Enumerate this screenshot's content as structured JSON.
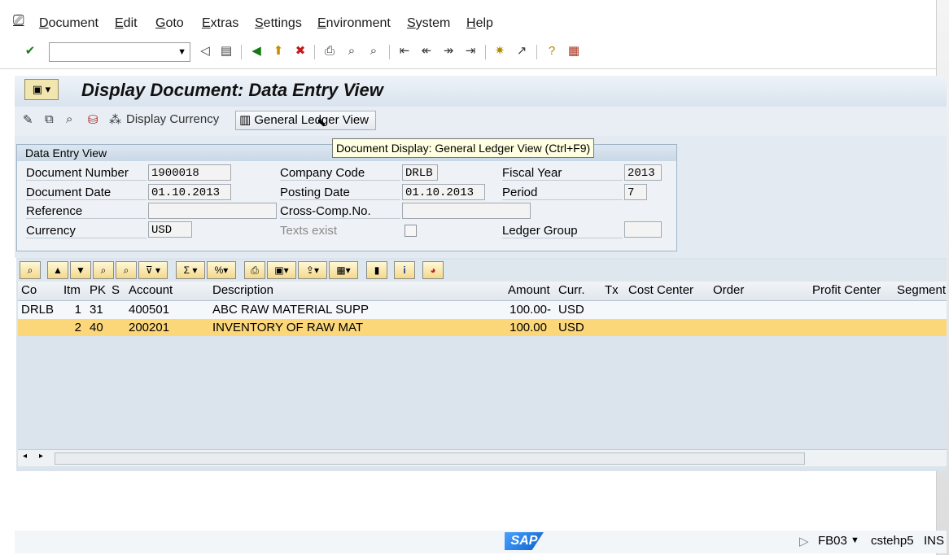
{
  "menu": {
    "items": [
      "Document",
      "Edit",
      "Goto",
      "Extras",
      "Settings",
      "Environment",
      "System",
      "Help"
    ]
  },
  "toolbar": {
    "command_field_value": "",
    "icons": [
      "enter-check-icon",
      "back-triangle-icon",
      "save-icon",
      "back-green-icon",
      "exit-icon",
      "cancel-icon",
      "print-icon",
      "find-icon",
      "find-next-icon",
      "first-page-icon",
      "prev-page-icon",
      "next-page-icon",
      "last-page-icon",
      "create-session-icon",
      "shortcut-icon",
      "help-icon",
      "customize-layout-icon"
    ]
  },
  "title": "Display Document: Data Entry View",
  "app_toolbar": {
    "display_currency_label": "Display Currency",
    "general_ledger_label": "General Ledger View"
  },
  "tooltip": "Document Display: General Ledger View    (Ctrl+F9)",
  "group": {
    "title": "Data Entry View",
    "document_number_label": "Document Number",
    "document_number": "1900018",
    "company_code_label": "Company Code",
    "company_code": "DRLB",
    "fiscal_year_label": "Fiscal Year",
    "fiscal_year": "2013",
    "document_date_label": "Document Date",
    "document_date": "01.10.2013",
    "posting_date_label": "Posting Date",
    "posting_date": "01.10.2013",
    "period_label": "Period",
    "period": "7",
    "reference_label": "Reference",
    "reference": "",
    "cross_comp_label": "Cross-Comp.No.",
    "cross_comp": "",
    "currency_label": "Currency",
    "currency": "USD",
    "texts_exist_label": "Texts exist",
    "ledger_group_label": "Ledger Group",
    "ledger_group": ""
  },
  "table": {
    "columns": [
      "Co",
      "Itm",
      "PK",
      "S",
      "Account",
      "Description",
      "Amount",
      "Curr.",
      "Tx",
      "Cost Center",
      "Order",
      "Profit Center",
      "Segment"
    ],
    "rows": [
      {
        "co": "DRLB",
        "itm": "1",
        "pk": "31",
        "s": "",
        "account": "400501",
        "description": "ABC RAW MATERIAL SUPP",
        "amount": "100.00-",
        "curr": "USD"
      },
      {
        "co": "",
        "itm": "2",
        "pk": "40",
        "s": "",
        "account": "200201",
        "description": "INVENTORY OF RAW MAT",
        "amount": "100.00",
        "curr": "USD"
      }
    ],
    "selected_row": 1
  },
  "status": {
    "transaction": "FB03",
    "server": "cstehp5",
    "mode": "INS",
    "logo": "SAP"
  }
}
